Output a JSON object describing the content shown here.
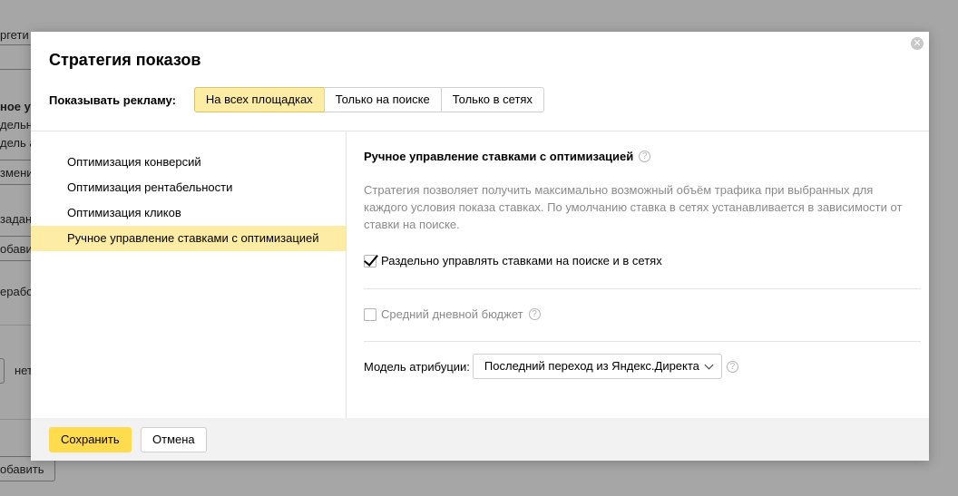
{
  "background": {
    "fragments": [
      "ргети",
      "ное уп",
      "дельн",
      "дель ат",
      "змени",
      "задань",
      "обави",
      "ерабо",
      "нет",
      "обавить"
    ]
  },
  "modal": {
    "title": "Стратегия показов",
    "close_glyph": "✕",
    "show_label": "Показывать рекламу:",
    "placements": [
      {
        "label": "На всех площадках",
        "active": true
      },
      {
        "label": "Только на поиске",
        "active": false
      },
      {
        "label": "Только в сетях",
        "active": false
      }
    ],
    "strategies": [
      {
        "label": "Оптимизация конверсий",
        "active": false
      },
      {
        "label": "Оптимизация рентабельности",
        "active": false
      },
      {
        "label": "Оптимизация кликов",
        "active": false
      },
      {
        "label": "Ручное управление ставками с оптимизацией",
        "active": true
      }
    ],
    "detail": {
      "title": "Ручное управление ставками с оптимизацией",
      "help_glyph": "?",
      "description": "Стратегия позволяет получить максимально возможный объём трафика при выбранных для каждого условия показа ставках. По умолчанию ставка в сетях устанавливается в зависимости от ставки на поиске.",
      "separate_label": "Раздельно управлять ставками на поиске и в сетях",
      "separate_checked": true,
      "budget_label": "Средний дневной бюджет",
      "budget_checked": false,
      "attribution_label": "Модель атрибуции:",
      "attribution_value": "Последний переход из Яндекс.Директа"
    },
    "footer": {
      "save_label": "Сохранить",
      "cancel_label": "Отмена"
    }
  }
}
